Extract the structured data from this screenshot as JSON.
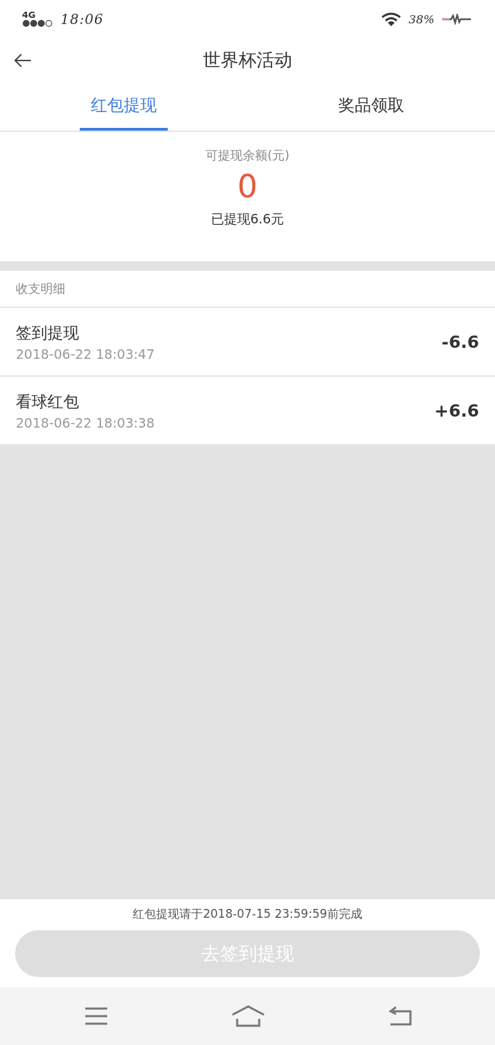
{
  "status_bar": {
    "network": "4G",
    "time": "18:06",
    "battery": "38%"
  },
  "header": {
    "title": "世界杯活动"
  },
  "tabs": [
    {
      "label": "红包提现",
      "selected": true
    },
    {
      "label": "奖品领取",
      "selected": false
    }
  ],
  "balance": {
    "label": "可提现余额(元)",
    "amount": "0",
    "withdrawn": "已提现6.6元"
  },
  "details": {
    "title": "收支明细",
    "rows": [
      {
        "name": "签到提现",
        "time": "2018-06-22 18:03:47",
        "amount": "-6.6"
      },
      {
        "name": "看球红包",
        "time": "2018-06-22 18:03:38",
        "amount": "+6.6"
      }
    ]
  },
  "footer": {
    "notice": "红包提现请于2018-07-15 23:59:59前完成",
    "button": {
      "label": "去签到提现",
      "disabled": true
    }
  }
}
